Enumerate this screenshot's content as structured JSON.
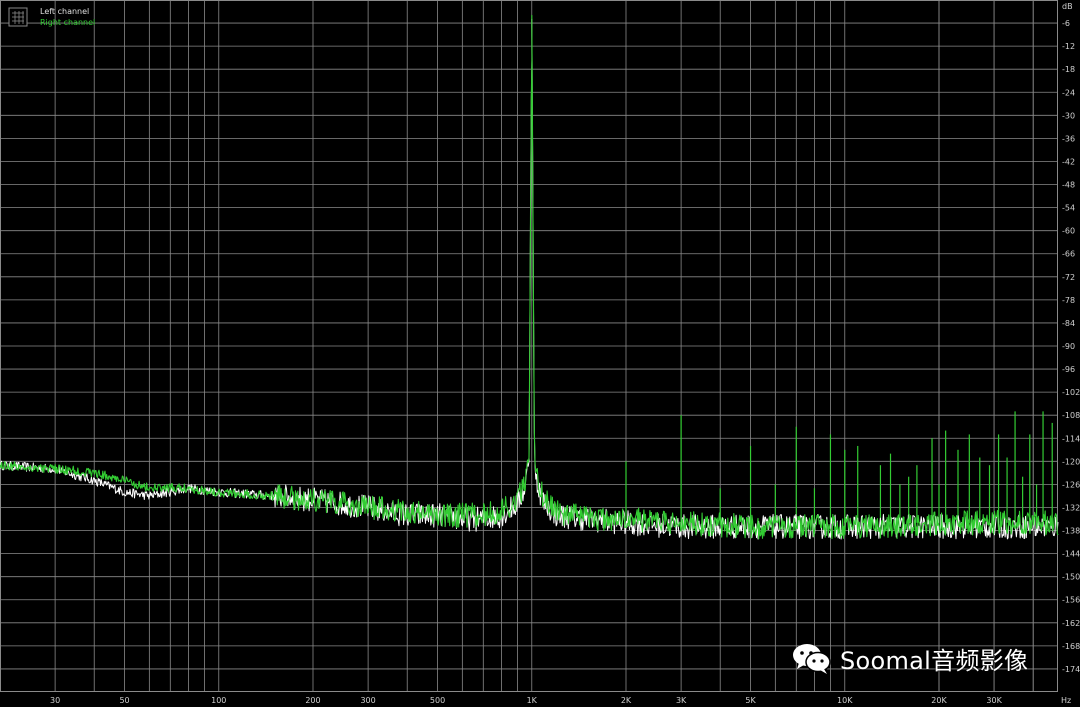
{
  "chart_data": {
    "type": "line",
    "xlabel": "Hz",
    "ylabel": "dB",
    "x_scale": "log",
    "xlim": [
      20,
      48000
    ],
    "ylim": [
      -180,
      0
    ],
    "grid": true,
    "legend_position": "top-left",
    "x_tick_labels": [
      {
        "value": 30,
        "label": "30"
      },
      {
        "value": 50,
        "label": "50"
      },
      {
        "value": 100,
        "label": "100"
      },
      {
        "value": 200,
        "label": "200"
      },
      {
        "value": 300,
        "label": "300"
      },
      {
        "value": 500,
        "label": "500"
      },
      {
        "value": 1000,
        "label": "1K"
      },
      {
        "value": 2000,
        "label": "2K"
      },
      {
        "value": 3000,
        "label": "3K"
      },
      {
        "value": 5000,
        "label": "5K"
      },
      {
        "value": 10000,
        "label": "10K"
      },
      {
        "value": 20000,
        "label": "20K"
      },
      {
        "value": 30000,
        "label": "30K"
      }
    ],
    "y_tick_labels": [
      "-6",
      "-12",
      "-18",
      "-24",
      "-30",
      "-36",
      "-42",
      "-48",
      "-54",
      "-60",
      "-66",
      "-72",
      "-78",
      "-84",
      "-90",
      "-96",
      "-102",
      "-108",
      "-114",
      "-120",
      "-126",
      "-132",
      "-138",
      "-144",
      "-150",
      "-156",
      "-162",
      "-168",
      "-174"
    ],
    "y_ticks": [
      -6,
      -12,
      -18,
      -24,
      -30,
      -36,
      -42,
      -48,
      -54,
      -60,
      -66,
      -72,
      -78,
      -84,
      -90,
      -96,
      -102,
      -108,
      -114,
      -120,
      -126,
      -132,
      -138,
      -144,
      -150,
      -156,
      -162,
      -168,
      -174
    ],
    "series": [
      {
        "name": "Left channel",
        "color": "#ffffff",
        "x": [
          20,
          30,
          40,
          50,
          60,
          80,
          100,
          150,
          200,
          300,
          400,
          500,
          600,
          700,
          800,
          900,
          950,
          980,
          1000,
          1020,
          1050,
          1100,
          1200,
          1500,
          2000,
          3000,
          5000,
          7000,
          10000,
          15000,
          20000,
          30000,
          40000,
          48000
        ],
        "y": [
          -121,
          -122,
          -125,
          -128,
          -129,
          -127,
          -128,
          -129,
          -130,
          -132,
          -134,
          -134,
          -135,
          -135,
          -134,
          -131,
          -127,
          -120,
          -5,
          -120,
          -127,
          -131,
          -134,
          -135,
          -136,
          -137,
          -137,
          -137,
          -137,
          -137,
          -137,
          -137,
          -137,
          -137
        ]
      },
      {
        "name": "Right channel",
        "color": "#33cc33",
        "x": [
          20,
          30,
          40,
          50,
          60,
          80,
          100,
          150,
          200,
          300,
          400,
          500,
          600,
          700,
          800,
          900,
          950,
          980,
          1000,
          1020,
          1050,
          1100,
          1200,
          1500,
          2000,
          3000,
          5000,
          7000,
          10000,
          15000,
          20000,
          30000,
          40000,
          48000
        ],
        "y": [
          -121,
          -122,
          -123,
          -125,
          -127,
          -127,
          -128,
          -129,
          -130,
          -132,
          -133,
          -134,
          -134,
          -134,
          -133,
          -130,
          -126,
          -119,
          -4,
          -119,
          -126,
          -130,
          -133,
          -135,
          -135,
          -136,
          -137,
          -137,
          -137,
          -137,
          -136,
          -136,
          -136,
          -136
        ]
      }
    ],
    "harmonics": [
      {
        "x": 2000,
        "y": -120
      },
      {
        "x": 3000,
        "y": -108
      },
      {
        "x": 4000,
        "y": -127
      },
      {
        "x": 5000,
        "y": -116
      },
      {
        "x": 6000,
        "y": -126
      },
      {
        "x": 7000,
        "y": -111
      },
      {
        "x": 8000,
        "y": -127
      },
      {
        "x": 9000,
        "y": -113
      },
      {
        "x": 10000,
        "y": -117
      },
      {
        "x": 11000,
        "y": -116
      },
      {
        "x": 13000,
        "y": -121
      },
      {
        "x": 14000,
        "y": -118
      },
      {
        "x": 15000,
        "y": -126
      },
      {
        "x": 16000,
        "y": -124
      },
      {
        "x": 17000,
        "y": -121
      },
      {
        "x": 19000,
        "y": -114
      },
      {
        "x": 20000,
        "y": -126
      },
      {
        "x": 21000,
        "y": -112
      },
      {
        "x": 23000,
        "y": -117
      },
      {
        "x": 25000,
        "y": -113
      },
      {
        "x": 27000,
        "y": -119
      },
      {
        "x": 29000,
        "y": -121
      },
      {
        "x": 31000,
        "y": -113
      },
      {
        "x": 33000,
        "y": -119
      },
      {
        "x": 35000,
        "y": -107
      },
      {
        "x": 37000,
        "y": -124
      },
      {
        "x": 39000,
        "y": -113
      },
      {
        "x": 41000,
        "y": -126
      },
      {
        "x": 43000,
        "y": -107
      },
      {
        "x": 46000,
        "y": -110
      }
    ]
  },
  "watermark": {
    "text": "Soomal音频影像"
  }
}
